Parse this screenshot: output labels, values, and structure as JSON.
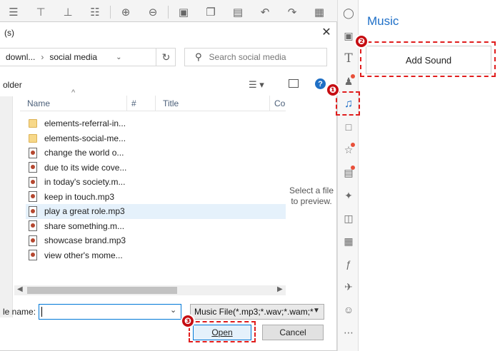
{
  "dialog": {
    "title_fragment": "(s)",
    "address_path_1": "downl...",
    "address_path_2": "social media",
    "search_placeholder": "Search social media",
    "command_left_text": "older",
    "preview_text": "Select a file to preview."
  },
  "columns": [
    "Name",
    "#",
    "Title",
    "Co"
  ],
  "files": [
    {
      "name": "elements-referral-in...",
      "type": "folder",
      "selected": false
    },
    {
      "name": "elements-social-me...",
      "type": "folder",
      "selected": false
    },
    {
      "name": "change the world o...",
      "type": "audio",
      "selected": false
    },
    {
      "name": "due to its wide cove...",
      "type": "audio",
      "selected": false
    },
    {
      "name": "in today's society.m...",
      "type": "audio",
      "selected": false
    },
    {
      "name": "keep in touch.mp3",
      "type": "audio",
      "selected": false
    },
    {
      "name": "play a great role.mp3",
      "type": "audio",
      "selected": true
    },
    {
      "name": "share something.m...",
      "type": "audio",
      "selected": false
    },
    {
      "name": "showcase brand.mp3",
      "type": "audio",
      "selected": false
    },
    {
      "name": "view other's mome...",
      "type": "audio",
      "selected": false
    }
  ],
  "bottom": {
    "file_name_label": "le name:",
    "file_name_value": "",
    "file_type": "Music File(*.mp3;*.wav;*.wam;*",
    "open_label": "Open",
    "cancel_label": "Cancel"
  },
  "panel": {
    "title": "Music",
    "add_sound_label": "Add Sound"
  },
  "badges": [
    "❶",
    "❷",
    "❸"
  ],
  "colors": {
    "accent": "#1e6fc7",
    "highlight": "#e01d1d",
    "selection": "#e5f1fb"
  }
}
